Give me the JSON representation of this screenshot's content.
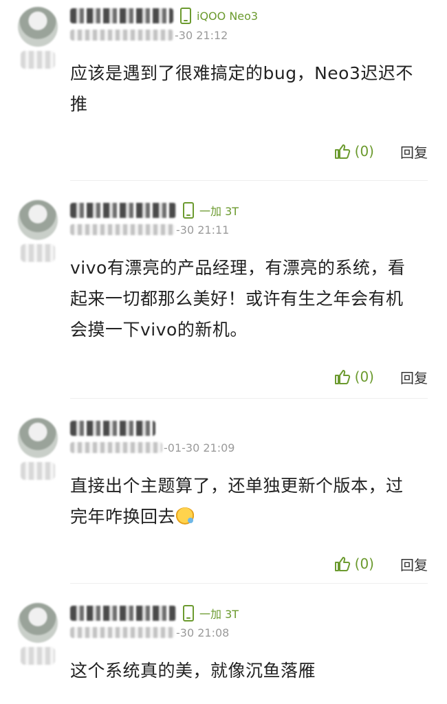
{
  "comments": [
    {
      "device": "iQOO Neo3",
      "time": "-30 21:12",
      "content_line1": "应该是遇到了很难搞定的bug，Neo3迟迟不",
      "content_line2": "推",
      "likes": "(0)",
      "reply_label": "回复"
    },
    {
      "device": "一加 3T",
      "time": "-30 21:11",
      "content_line1": "vivo有漂亮的产品经理，有漂亮的系统，看",
      "content_line2": "起来一切都那么美好！或许有生之年会有机",
      "content_line3": "会摸一下vivo的新机。",
      "likes": "(0)",
      "reply_label": "回复"
    },
    {
      "time": "-01-30 21:09",
      "content_line1": "直接出个主题算了，还单独更新个版本，过",
      "content_line2": "完年咋换回去",
      "likes": "(0)",
      "reply_label": "回复"
    },
    {
      "device": "一加 3T",
      "time": "-30 21:08",
      "content_line1": "这个系统真的美，就像沉鱼落雁"
    }
  ],
  "icons": {
    "like": "thumb-up-icon",
    "device": "phone-icon"
  },
  "colors": {
    "accent": "#6b9a2e",
    "text": "#222222",
    "muted": "#9a9a9a"
  }
}
